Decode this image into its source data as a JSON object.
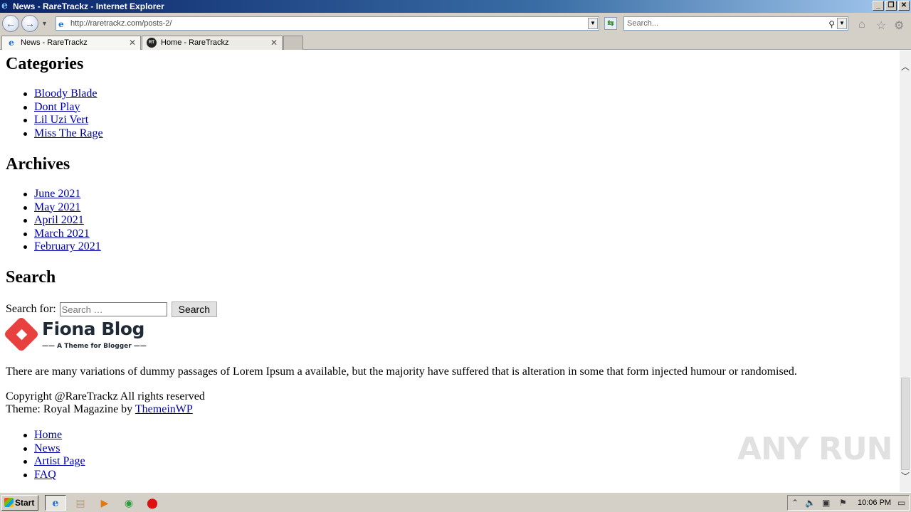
{
  "window": {
    "title": "News - RareTrackz - Internet Explorer"
  },
  "browser": {
    "address": "http://raretrackz.com/posts-2/",
    "search_placeholder": "Search...",
    "tabs": [
      {
        "label": "News - RareTrackz"
      },
      {
        "label": "Home - RareTrackz"
      }
    ]
  },
  "page": {
    "categories": {
      "heading": "Categories",
      "items": [
        "Bloody Blade",
        "Dont Play",
        "Lil Uzi Vert",
        "Miss The Rage"
      ]
    },
    "archives": {
      "heading": "Archives",
      "items": [
        "June 2021",
        "May 2021",
        "April 2021",
        "March 2021",
        "February 2021"
      ]
    },
    "search": {
      "heading": "Search",
      "label": "Search for:",
      "placeholder": "Search …",
      "button": "Search"
    },
    "logo": {
      "title": "Fiona Blog",
      "tagline": "—— A Theme for Blogger ——"
    },
    "description": "There are many variations of dummy passages of Lorem Ipsum a available, but the majority have suffered that is alteration in some that form injected humour or randomised.",
    "copyright": "Copyright @RareTrackz All rights reserved",
    "theme_prefix": "Theme: Royal Magazine by",
    "theme_link": "ThemeinWP",
    "footer_nav": [
      "Home",
      "News",
      "Artist Page",
      "FAQ"
    ],
    "watermark": "ANY RUN"
  },
  "taskbar": {
    "start": "Start",
    "clock": "10:06 PM"
  }
}
